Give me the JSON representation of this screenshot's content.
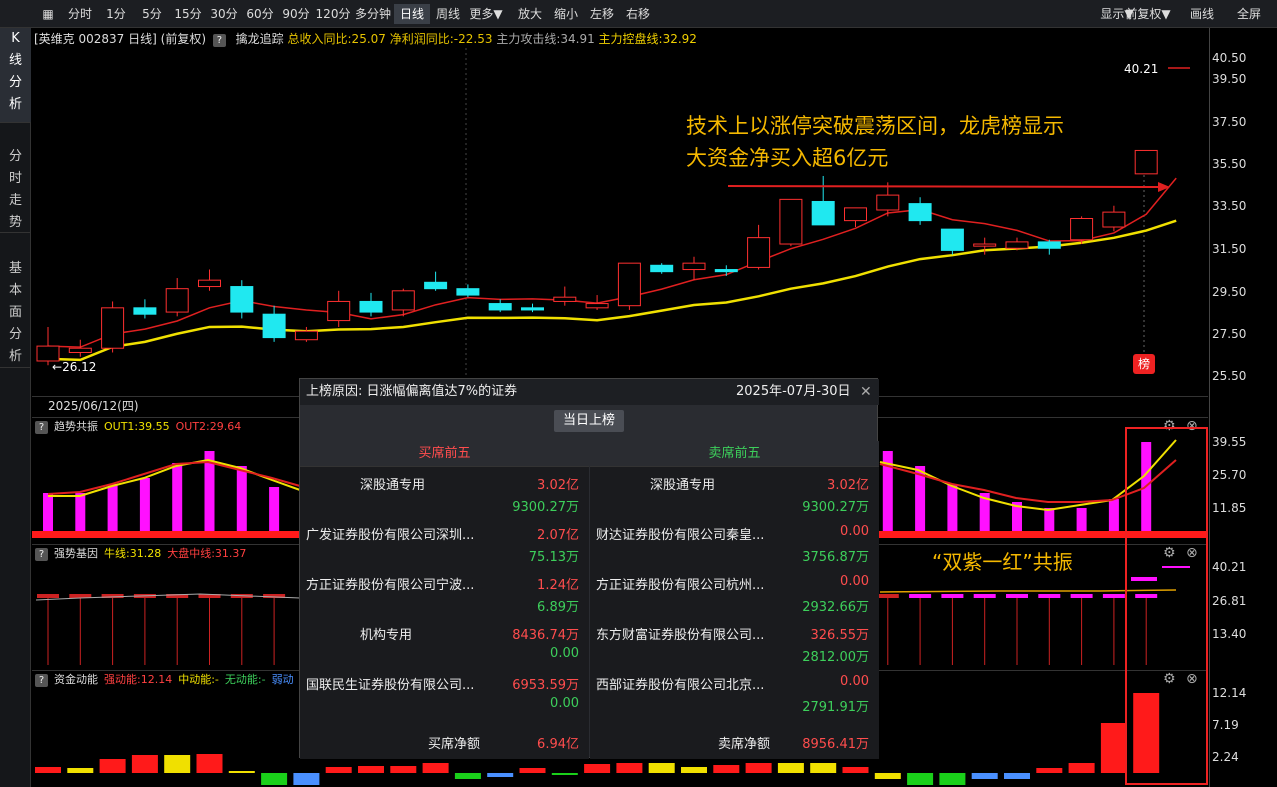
{
  "toolbar": {
    "periods": [
      "分时",
      "1分",
      "5分",
      "15分",
      "30分",
      "60分",
      "90分",
      "120分",
      "多分钟",
      "日线",
      "周线",
      "更多▼",
      "放大",
      "缩小",
      "左移",
      "右移"
    ],
    "selected": "日线",
    "right": [
      "显示▼",
      "前复权▼",
      "画线",
      "全屏"
    ]
  },
  "leftnav": [
    "K线分析",
    "分时走势",
    "基本面分析"
  ],
  "chart_header": {
    "stock": "[英维克 002837 日线]",
    "adj": "(前复权)",
    "indicator": "擒龙追踪",
    "f1": "总收入同比:25.07",
    "f2": "净利润同比:-22.53",
    "f3": "主力攻击线:34.91",
    "f4": "主力控盘线:32.92"
  },
  "price_axis": [
    "40.50",
    "39.50",
    "37.50",
    "35.50",
    "33.50",
    "31.50",
    "29.50",
    "27.50",
    "25.50"
  ],
  "high_label": "40.21",
  "low_label": "26.12",
  "date_label": "2025/06/12(四)",
  "annotation": {
    "line1": "技术上以涨停突破震荡区间，龙虎榜显示",
    "line2": "大资金净买入超6亿元"
  },
  "lhb_badge": "榜",
  "ind1": {
    "name": "趋势共振",
    "out1": "OUT1:39.55",
    "out2": "OUT2:29.64",
    "axis": [
      "39.55",
      "25.70",
      "11.85"
    ]
  },
  "ind2": {
    "name": "强势基因",
    "a": "牛线:31.28",
    "b": "大盘中线:31.37",
    "axis": [
      "40.21",
      "26.81",
      "13.40"
    ]
  },
  "ind3": {
    "name": "资金动能",
    "a": "强动能:12.14",
    "b": "中动能:-",
    "c": "无动能:-",
    "d": "弱动",
    "axis": [
      "12.14",
      "7.19",
      "2.24"
    ]
  },
  "resonance": "“双紫一红”共振",
  "popup": {
    "reason": "上榜原因: 日涨幅偏离值达7%的证券",
    "date": "2025年-07月-30日",
    "button": "当日上榜",
    "buy_title": "买席前五",
    "sell_title": "卖席前五",
    "buy": [
      {
        "name": "深股通专用",
        "buy": "3.02亿",
        "sell": "9300.27万"
      },
      {
        "name": "广发证券股份有限公司深圳...",
        "buy": "2.07亿",
        "sell": "75.13万"
      },
      {
        "name": "方正证券股份有限公司宁波...",
        "buy": "1.24亿",
        "sell": "6.89万"
      },
      {
        "name": "机构专用",
        "buy": "8436.74万",
        "sell": "0.00"
      },
      {
        "name": "国联民生证券股份有限公司...",
        "buy": "6953.59万",
        "sell": "0.00"
      }
    ],
    "sell": [
      {
        "name": "深股通专用",
        "buy": "3.02亿",
        "sell": "9300.27万"
      },
      {
        "name": "财达证券股份有限公司秦皇...",
        "buy": "0.00",
        "sell": "3756.87万"
      },
      {
        "name": "方正证券股份有限公司杭州...",
        "buy": "0.00",
        "sell": "2932.66万"
      },
      {
        "name": "东方财富证券股份有限公司...",
        "buy": "326.55万",
        "sell": "2812.00万"
      },
      {
        "name": "西部证券股份有限公司北京...",
        "buy": "0.00",
        "sell": "2791.91万"
      }
    ],
    "buy_net_label": "买席净额",
    "buy_net": "6.94亿",
    "sell_net_label": "卖席净额",
    "sell_net": "8956.41万"
  },
  "candles": [
    {
      "o": 26.3,
      "c": 27.0,
      "h": 27.9,
      "l": 26.1
    },
    {
      "o": 26.7,
      "c": 26.9,
      "h": 27.3,
      "l": 26.5
    },
    {
      "o": 26.9,
      "c": 28.8,
      "h": 29.1,
      "l": 26.7
    },
    {
      "o": 28.8,
      "c": 28.5,
      "h": 29.2,
      "l": 28.3
    },
    {
      "o": 28.6,
      "c": 29.7,
      "h": 30.2,
      "l": 28.4
    },
    {
      "o": 29.8,
      "c": 30.1,
      "h": 30.6,
      "l": 29.6
    },
    {
      "o": 29.8,
      "c": 28.6,
      "h": 30.1,
      "l": 28.3
    },
    {
      "o": 28.5,
      "c": 27.4,
      "h": 28.9,
      "l": 27.2
    },
    {
      "o": 27.3,
      "c": 27.7,
      "h": 27.9,
      "l": 27.2
    },
    {
      "o": 28.2,
      "c": 29.1,
      "h": 29.6,
      "l": 27.9
    },
    {
      "o": 29.1,
      "c": 28.6,
      "h": 29.5,
      "l": 28.4
    },
    {
      "o": 28.7,
      "c": 29.6,
      "h": 29.7,
      "l": 28.4
    },
    {
      "o": 30.0,
      "c": 29.7,
      "h": 30.5,
      "l": 29.6
    },
    {
      "o": 29.7,
      "c": 29.4,
      "h": 29.9,
      "l": 29.3
    },
    {
      "o": 29.0,
      "c": 28.7,
      "h": 29.2,
      "l": 28.6
    },
    {
      "o": 28.8,
      "c": 28.7,
      "h": 29.0,
      "l": 28.6
    },
    {
      "o": 29.1,
      "c": 29.3,
      "h": 29.8,
      "l": 28.9
    },
    {
      "o": 28.8,
      "c": 29.0,
      "h": 29.4,
      "l": 28.7
    },
    {
      "o": 28.9,
      "c": 30.9,
      "h": 30.9,
      "l": 28.7
    },
    {
      "o": 30.8,
      "c": 30.5,
      "h": 30.9,
      "l": 30.4
    },
    {
      "o": 30.6,
      "c": 30.9,
      "h": 31.2,
      "l": 30.1
    },
    {
      "o": 30.6,
      "c": 30.5,
      "h": 30.8,
      "l": 30.3
    },
    {
      "o": 30.7,
      "c": 32.1,
      "h": 32.7,
      "l": 30.6
    },
    {
      "o": 31.8,
      "c": 33.9,
      "h": 33.9,
      "l": 31.7
    },
    {
      "o": 33.8,
      "c": 32.7,
      "h": 35.0,
      "l": 32.7
    },
    {
      "o": 32.9,
      "c": 33.5,
      "h": 33.5,
      "l": 32.6
    },
    {
      "o": 33.4,
      "c": 34.1,
      "h": 34.7,
      "l": 33.1
    },
    {
      "o": 33.7,
      "c": 32.9,
      "h": 34.0,
      "l": 32.7
    },
    {
      "o": 32.5,
      "c": 31.5,
      "h": 32.5,
      "l": 31.3
    },
    {
      "o": 31.7,
      "c": 31.8,
      "h": 32.1,
      "l": 31.3
    },
    {
      "o": 31.6,
      "c": 31.9,
      "h": 32.1,
      "l": 31.5
    },
    {
      "o": 31.9,
      "c": 31.6,
      "h": 32.0,
      "l": 31.3
    },
    {
      "o": 32.0,
      "c": 33.0,
      "h": 33.1,
      "l": 31.8
    },
    {
      "o": 32.6,
      "c": 33.3,
      "h": 33.6,
      "l": 32.4
    },
    {
      "o": 35.1,
      "c": 36.2,
      "h": 36.2,
      "l": 35.1
    }
  ]
}
